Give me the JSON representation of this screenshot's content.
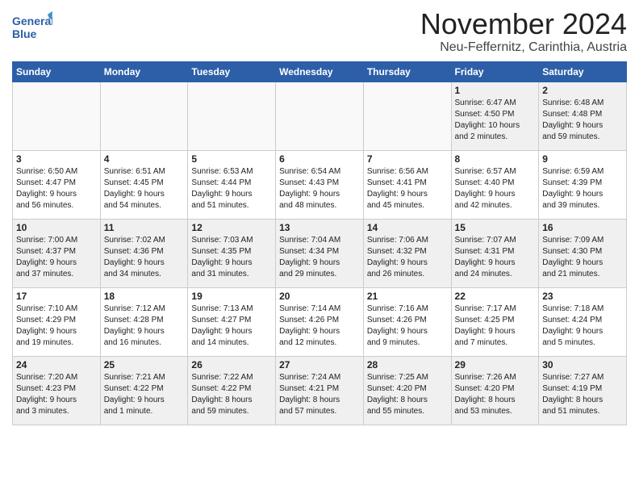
{
  "logo": {
    "line1": "General",
    "line2": "Blue"
  },
  "title": "November 2024",
  "location": "Neu-Feffernitz, Carinthia, Austria",
  "weekdays": [
    "Sunday",
    "Monday",
    "Tuesday",
    "Wednesday",
    "Thursday",
    "Friday",
    "Saturday"
  ],
  "weeks": [
    [
      {
        "day": "",
        "info": ""
      },
      {
        "day": "",
        "info": ""
      },
      {
        "day": "",
        "info": ""
      },
      {
        "day": "",
        "info": ""
      },
      {
        "day": "",
        "info": ""
      },
      {
        "day": "1",
        "info": "Sunrise: 6:47 AM\nSunset: 4:50 PM\nDaylight: 10 hours\nand 2 minutes."
      },
      {
        "day": "2",
        "info": "Sunrise: 6:48 AM\nSunset: 4:48 PM\nDaylight: 9 hours\nand 59 minutes."
      }
    ],
    [
      {
        "day": "3",
        "info": "Sunrise: 6:50 AM\nSunset: 4:47 PM\nDaylight: 9 hours\nand 56 minutes."
      },
      {
        "day": "4",
        "info": "Sunrise: 6:51 AM\nSunset: 4:45 PM\nDaylight: 9 hours\nand 54 minutes."
      },
      {
        "day": "5",
        "info": "Sunrise: 6:53 AM\nSunset: 4:44 PM\nDaylight: 9 hours\nand 51 minutes."
      },
      {
        "day": "6",
        "info": "Sunrise: 6:54 AM\nSunset: 4:43 PM\nDaylight: 9 hours\nand 48 minutes."
      },
      {
        "day": "7",
        "info": "Sunrise: 6:56 AM\nSunset: 4:41 PM\nDaylight: 9 hours\nand 45 minutes."
      },
      {
        "day": "8",
        "info": "Sunrise: 6:57 AM\nSunset: 4:40 PM\nDaylight: 9 hours\nand 42 minutes."
      },
      {
        "day": "9",
        "info": "Sunrise: 6:59 AM\nSunset: 4:39 PM\nDaylight: 9 hours\nand 39 minutes."
      }
    ],
    [
      {
        "day": "10",
        "info": "Sunrise: 7:00 AM\nSunset: 4:37 PM\nDaylight: 9 hours\nand 37 minutes."
      },
      {
        "day": "11",
        "info": "Sunrise: 7:02 AM\nSunset: 4:36 PM\nDaylight: 9 hours\nand 34 minutes."
      },
      {
        "day": "12",
        "info": "Sunrise: 7:03 AM\nSunset: 4:35 PM\nDaylight: 9 hours\nand 31 minutes."
      },
      {
        "day": "13",
        "info": "Sunrise: 7:04 AM\nSunset: 4:34 PM\nDaylight: 9 hours\nand 29 minutes."
      },
      {
        "day": "14",
        "info": "Sunrise: 7:06 AM\nSunset: 4:32 PM\nDaylight: 9 hours\nand 26 minutes."
      },
      {
        "day": "15",
        "info": "Sunrise: 7:07 AM\nSunset: 4:31 PM\nDaylight: 9 hours\nand 24 minutes."
      },
      {
        "day": "16",
        "info": "Sunrise: 7:09 AM\nSunset: 4:30 PM\nDaylight: 9 hours\nand 21 minutes."
      }
    ],
    [
      {
        "day": "17",
        "info": "Sunrise: 7:10 AM\nSunset: 4:29 PM\nDaylight: 9 hours\nand 19 minutes."
      },
      {
        "day": "18",
        "info": "Sunrise: 7:12 AM\nSunset: 4:28 PM\nDaylight: 9 hours\nand 16 minutes."
      },
      {
        "day": "19",
        "info": "Sunrise: 7:13 AM\nSunset: 4:27 PM\nDaylight: 9 hours\nand 14 minutes."
      },
      {
        "day": "20",
        "info": "Sunrise: 7:14 AM\nSunset: 4:26 PM\nDaylight: 9 hours\nand 12 minutes."
      },
      {
        "day": "21",
        "info": "Sunrise: 7:16 AM\nSunset: 4:26 PM\nDaylight: 9 hours\nand 9 minutes."
      },
      {
        "day": "22",
        "info": "Sunrise: 7:17 AM\nSunset: 4:25 PM\nDaylight: 9 hours\nand 7 minutes."
      },
      {
        "day": "23",
        "info": "Sunrise: 7:18 AM\nSunset: 4:24 PM\nDaylight: 9 hours\nand 5 minutes."
      }
    ],
    [
      {
        "day": "24",
        "info": "Sunrise: 7:20 AM\nSunset: 4:23 PM\nDaylight: 9 hours\nand 3 minutes."
      },
      {
        "day": "25",
        "info": "Sunrise: 7:21 AM\nSunset: 4:22 PM\nDaylight: 9 hours\nand 1 minute."
      },
      {
        "day": "26",
        "info": "Sunrise: 7:22 AM\nSunset: 4:22 PM\nDaylight: 8 hours\nand 59 minutes."
      },
      {
        "day": "27",
        "info": "Sunrise: 7:24 AM\nSunset: 4:21 PM\nDaylight: 8 hours\nand 57 minutes."
      },
      {
        "day": "28",
        "info": "Sunrise: 7:25 AM\nSunset: 4:20 PM\nDaylight: 8 hours\nand 55 minutes."
      },
      {
        "day": "29",
        "info": "Sunrise: 7:26 AM\nSunset: 4:20 PM\nDaylight: 8 hours\nand 53 minutes."
      },
      {
        "day": "30",
        "info": "Sunrise: 7:27 AM\nSunset: 4:19 PM\nDaylight: 8 hours\nand 51 minutes."
      }
    ]
  ]
}
